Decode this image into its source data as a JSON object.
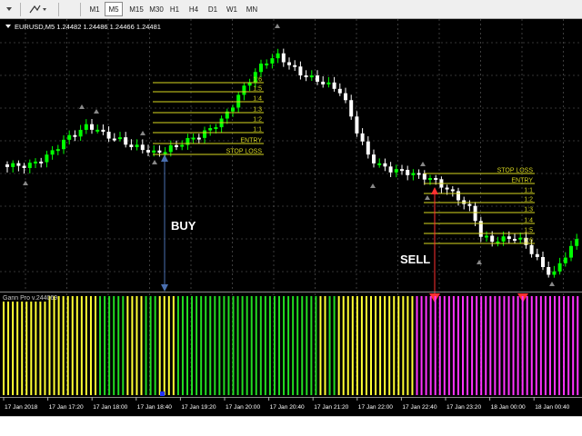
{
  "toolbar": {
    "dropdown_icon": "dropdown-arrow-icon",
    "tool_icon": "objects-tool-icon",
    "timeframes": [
      "M1",
      "M5",
      "M15",
      "M30",
      "H1",
      "H4",
      "D1",
      "W1",
      "MN"
    ],
    "active_timeframe": "M5"
  },
  "chart": {
    "symbol_info": "EURUSD,M5  1.24482 1.24486 1.24466 1.24481",
    "buy_label": "BUY",
    "sell_label": "SELL",
    "buy_levels": [
      "1:6",
      "1:5",
      "1:4",
      "1:3",
      "1:2",
      "1:1",
      "ENTRY",
      "STOP LOSS"
    ],
    "sell_levels": [
      "STOP LOSS",
      "ENTRY",
      "1:1",
      "1:2",
      "1:3",
      "1:4",
      "1:5",
      "1:6"
    ],
    "colors": {
      "background": "#000000",
      "grid": "#666666",
      "bull": "#00ff00",
      "bear": "#ffffff",
      "levels": "#d8d820",
      "buy_arrow": "#4a6fb0",
      "sell_arrow": "#ff3030"
    }
  },
  "indicator": {
    "name": "Gann Pro v.244069",
    "colors": {
      "yellow": "#ffff33",
      "green": "#22dd22",
      "magenta": "#ff33ff"
    }
  },
  "time_axis": {
    "labels": [
      "17 Jan 2018",
      "17 Jan 17:20",
      "17 Jan 18:00",
      "17 Jan 18:40",
      "17 Jan 19:20",
      "17 Jan 20:00",
      "17 Jan 20:40",
      "17 Jan 21:20",
      "17 Jan 22:00",
      "17 Jan 22:40",
      "17 Jan 23:20",
      "18 Jan 00:00",
      "18 Jan 00:40"
    ]
  }
}
